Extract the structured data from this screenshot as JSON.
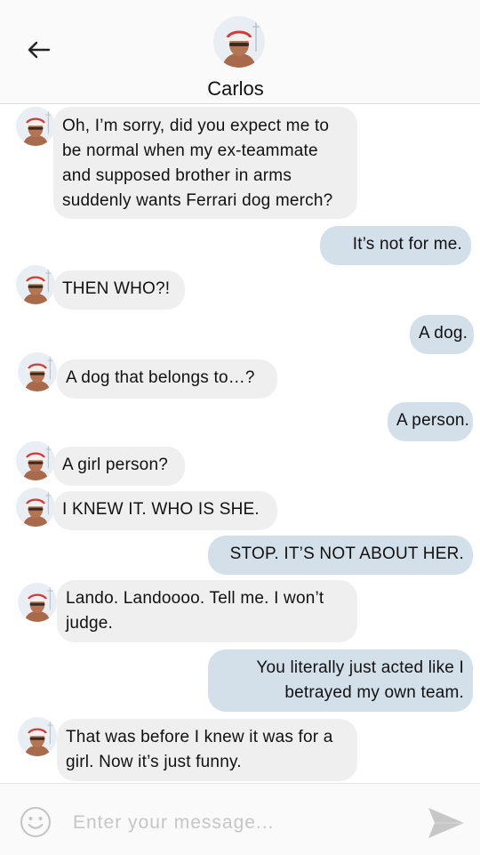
{
  "header": {
    "back_icon": "arrow-left-icon",
    "contact_name": "Carlos"
  },
  "messages": [
    {
      "side": "in",
      "lines": [
        "Oh, I’m sorry, did you expect me to",
        "be normal when my ex-teammate",
        "and supposed brother in arms",
        "suddenly wants Ferrari dog merch?"
      ]
    },
    {
      "side": "out",
      "lines": [
        "It’s not for me."
      ]
    },
    {
      "side": "in",
      "lines": [
        "THEN WHO?!"
      ]
    },
    {
      "side": "out",
      "lines": [
        "A dog."
      ]
    },
    {
      "side": "in",
      "lines": [
        "A dog that belongs to…?"
      ]
    },
    {
      "side": "out",
      "lines": [
        "A person."
      ]
    },
    {
      "side": "in",
      "lines": [
        "A girl person?"
      ]
    },
    {
      "side": "in",
      "lines": [
        "I KNEW IT. WHO IS SHE."
      ]
    },
    {
      "side": "out",
      "lines": [
        "STOP. IT’S NOT ABOUT HER."
      ]
    },
    {
      "side": "in",
      "lines": [
        "Lando. Landoooo. Tell me. I won’t",
        "judge."
      ]
    },
    {
      "side": "out",
      "lines": [
        "You literally just acted like I",
        "betrayed my own team."
      ]
    },
    {
      "side": "in",
      "lines": [
        "That was before I knew it was for a",
        "girl. Now it’s just funny."
      ]
    }
  ],
  "composer": {
    "emoji_icon": "smiley-icon",
    "placeholder": "Enter your message...",
    "send_icon": "send-icon"
  },
  "colors": {
    "incoming_bubble": "#efefef",
    "outgoing_bubble": "#d3e0ea",
    "header_bg": "#fafafa"
  }
}
